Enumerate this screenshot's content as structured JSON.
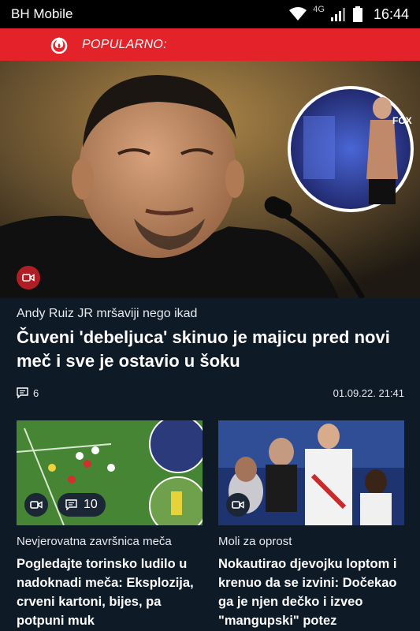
{
  "status_bar": {
    "carrier": "BH Mobile",
    "network_type": "4G",
    "time": "16:44"
  },
  "popular": {
    "label": "POPULARNO:"
  },
  "hero": {
    "kicker": "Andy Ruiz JR mršaviji nego ikad",
    "title": "Čuveni 'debeljuca' skinuo je majicu pred novi meč i sve je ostavio u šoku",
    "comments": "6",
    "date": "01.09.22. 21:41"
  },
  "cards": [
    {
      "kicker": "Nevjerovatna završnica meča",
      "title": "Pogledajte torinsko ludilo u nadoknadi meča: Eksplozija, crveni kartoni, bijes, pa potpuni muk",
      "comments": "10"
    },
    {
      "kicker": "Moli za oprost",
      "title": "Nokautirao djevojku loptom i krenuo da se izvini: Dočekao ga je njen dečko i izveo \"mangupski\" potez"
    }
  ],
  "colors": {
    "accent": "#e3222a",
    "background": "#0f1a27",
    "badge": "#b01e25"
  },
  "icons": [
    "wifi-icon",
    "signal-icon",
    "battery-icon",
    "fire-icon",
    "video-icon",
    "comment-icon"
  ]
}
